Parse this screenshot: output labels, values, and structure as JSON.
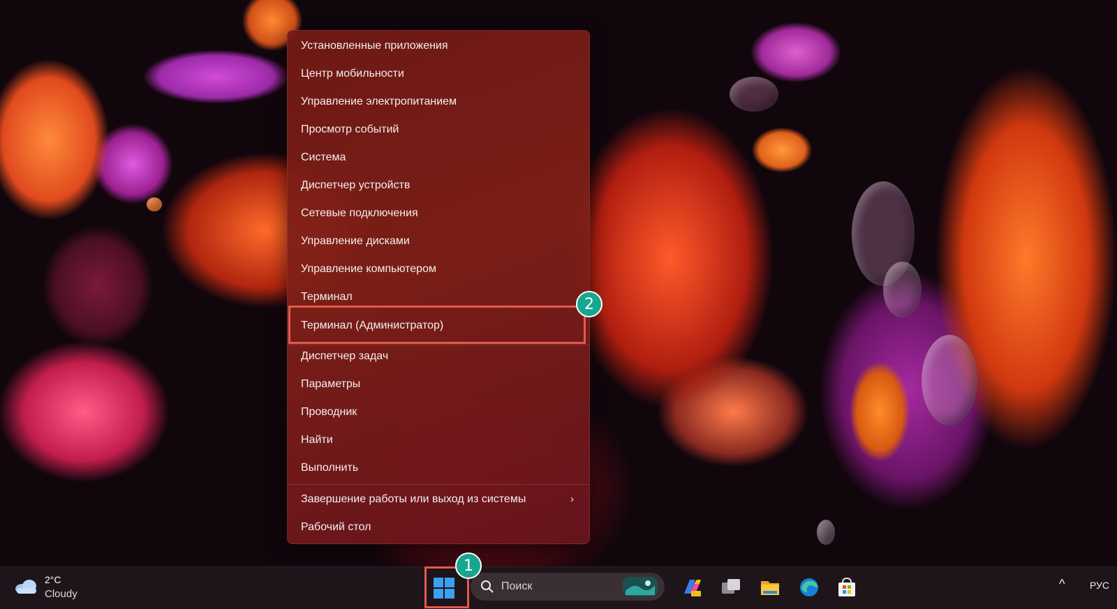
{
  "menu": {
    "items": [
      {
        "label": "Установленные приложения"
      },
      {
        "label": "Центр мобильности"
      },
      {
        "label": "Управление электропитанием"
      },
      {
        "label": "Просмотр событий"
      },
      {
        "label": "Система"
      },
      {
        "label": "Диспетчер устройств"
      },
      {
        "label": "Сетевые подключения"
      },
      {
        "label": "Управление дисками"
      },
      {
        "label": "Управление компьютером"
      },
      {
        "label": "Терминал"
      },
      {
        "label": "Терминал (Администратор)"
      },
      {
        "label": "Диспетчер задач"
      },
      {
        "label": "Параметры"
      },
      {
        "label": "Проводник"
      },
      {
        "label": "Найти"
      },
      {
        "label": "Выполнить"
      },
      {
        "label": "Завершение работы или выход из системы",
        "submenu_arrow": "›"
      },
      {
        "label": "Рабочий стол"
      }
    ]
  },
  "annotations": {
    "step1": "1",
    "step2": "2",
    "highlight_color": "#e35a4e",
    "badge_color": "#17a68f"
  },
  "taskbar": {
    "weather": {
      "temperature": "2°C",
      "condition": "Cloudy",
      "icon": "cloud-icon"
    },
    "search": {
      "placeholder": "Поиск"
    },
    "pinned": [
      "copilot-icon",
      "task-view-icon",
      "file-explorer-icon",
      "edge-icon",
      "store-icon"
    ],
    "tray": {
      "chevron": "^",
      "language": "РУС"
    }
  }
}
